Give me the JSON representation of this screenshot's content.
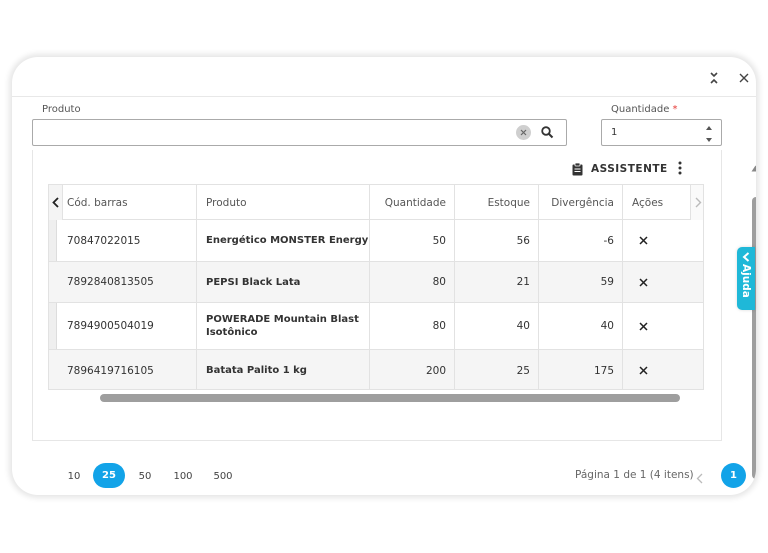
{
  "form": {
    "produto_label": "Produto",
    "produto_value": "",
    "quantidade_label": "Quantidade",
    "required_mark": "*",
    "quantidade_value": "1"
  },
  "toolbar": {
    "assistente_label": "ASSISTENTE"
  },
  "table": {
    "columns": [
      "Cód. barras",
      "Produto",
      "Quantidade",
      "Estoque",
      "Divergência",
      "Ações"
    ],
    "rows": [
      {
        "codigo": "70847022015",
        "produto": "Energético MONSTER Energy",
        "quantidade": "50",
        "estoque": "56",
        "divergencia": "-6"
      },
      {
        "codigo": "7892840813505",
        "produto": "PEPSI Black Lata",
        "quantidade": "80",
        "estoque": "21",
        "divergencia": "59"
      },
      {
        "codigo": "7894900504019",
        "produto": "POWERADE Mountain Blast Isotônico",
        "quantidade": "80",
        "estoque": "40",
        "divergencia": "40"
      },
      {
        "codigo": "7896419716105",
        "produto": "Batata Palito 1 kg",
        "quantidade": "200",
        "estoque": "25",
        "divergencia": "175"
      }
    ]
  },
  "pagination": {
    "page_sizes": [
      "10",
      "25",
      "50",
      "100",
      "500"
    ],
    "selected_page_size": "25",
    "page_info": "Página 1 de 1 (4 itens)",
    "current_page": "1"
  },
  "help": {
    "label": "Ajuda"
  },
  "colors": {
    "accent": "#12a3e8",
    "help_tab": "#1fb8d8",
    "required": "#e53935"
  },
  "icons": {
    "collapse": "collapse-icon",
    "close": "close-icon",
    "clear": "clear-icon",
    "search": "search-icon",
    "assistant": "clipboard-icon",
    "more": "more-vertical-icon",
    "delete": "x-icon",
    "help_chevron": "chevron-left-icon"
  }
}
